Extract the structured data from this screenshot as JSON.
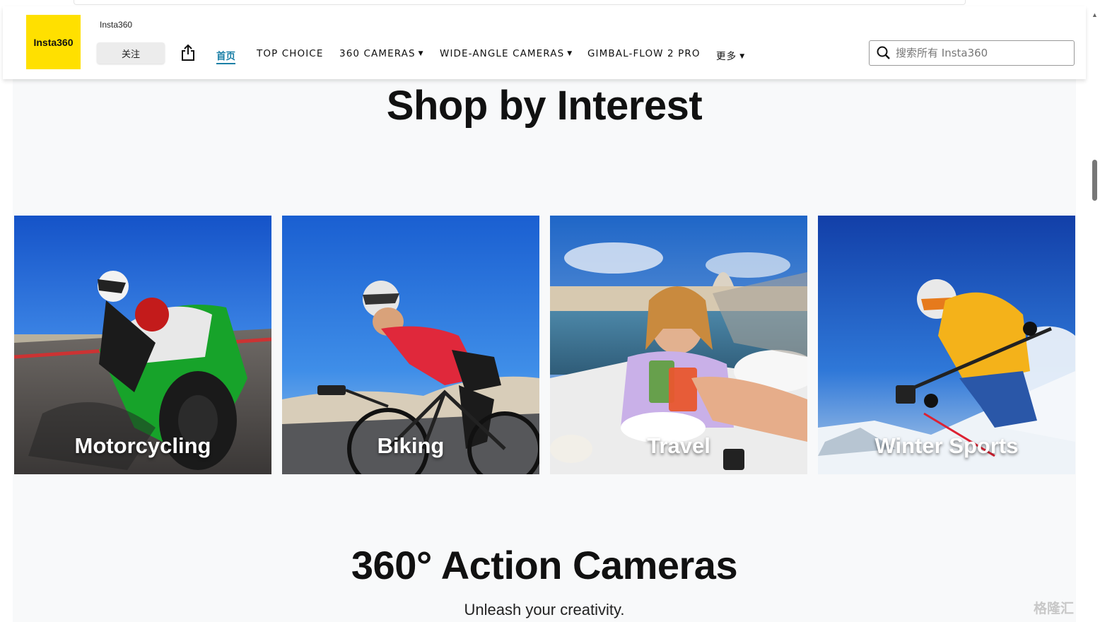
{
  "store": {
    "logo_text": "Insta360",
    "name": "Insta360",
    "follow_label": "关注",
    "logo_color": "#ffe000"
  },
  "nav": {
    "items": [
      {
        "label": "首页",
        "active": true
      },
      {
        "label": "TOP CHOICE"
      },
      {
        "label": "360 CAMERAS",
        "dropdown": true
      },
      {
        "label": "WIDE-ANGLE CAMERAS",
        "dropdown": true
      },
      {
        "label": "GIMBAL-FLOW 2 PRO"
      },
      {
        "label": "更多",
        "dropdown": true
      }
    ],
    "active_color": "#1a7fa6"
  },
  "search": {
    "placeholder": "搜索所有 Insta360",
    "icon": "search-icon"
  },
  "main": {
    "section_title": "Shop by Interest",
    "tiles": [
      {
        "label": "Motorcycling"
      },
      {
        "label": "Biking"
      },
      {
        "label": "Travel"
      },
      {
        "label": "Winter Sports"
      }
    ],
    "section2_title": "360° Action Cameras",
    "section2_subtitle": "Unleash your creativity."
  },
  "watermark": "格隆汇"
}
